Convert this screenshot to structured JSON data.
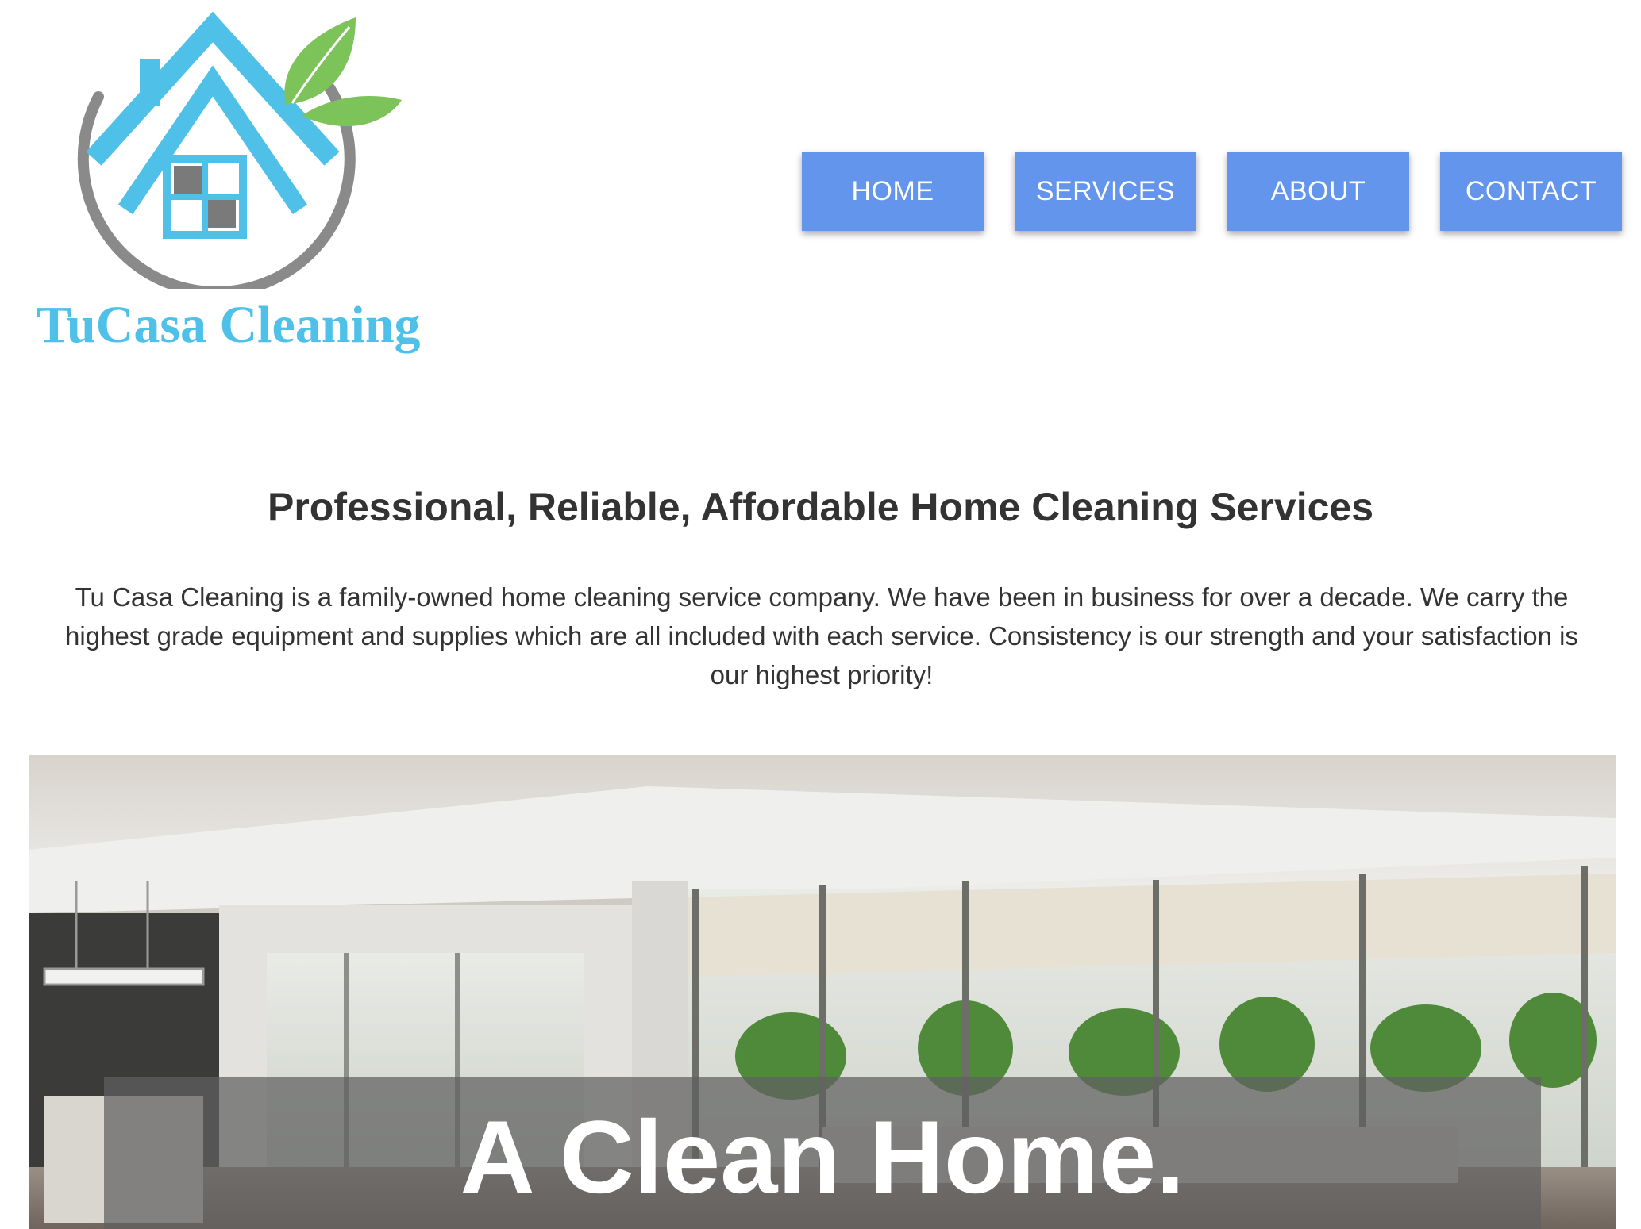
{
  "brand": {
    "name": "TuCasa Cleaning",
    "colors": {
      "house_blue": "#4fc1e9",
      "leaf_green": "#7cc35a",
      "swoosh_gray": "#8a8a8a",
      "window_gray": "#7a7a7a"
    }
  },
  "nav": {
    "items": [
      {
        "label": "HOME"
      },
      {
        "label": "SERVICES"
      },
      {
        "label": "ABOUT"
      },
      {
        "label": "CONTACT"
      }
    ],
    "button_color": "#6495ed"
  },
  "intro": {
    "headline": "Professional, Reliable, Affordable Home Cleaning Services",
    "body": "Tu Casa Cleaning is a family-owned home cleaning service company. We have been in business for over a decade. We carry the highest grade equipment and supplies which are all included with each service. Consistency is our strength and your satisfaction is our highest priority!"
  },
  "hero": {
    "title": "A Clean Home.",
    "image_icon": "interior-living-room-photo"
  }
}
